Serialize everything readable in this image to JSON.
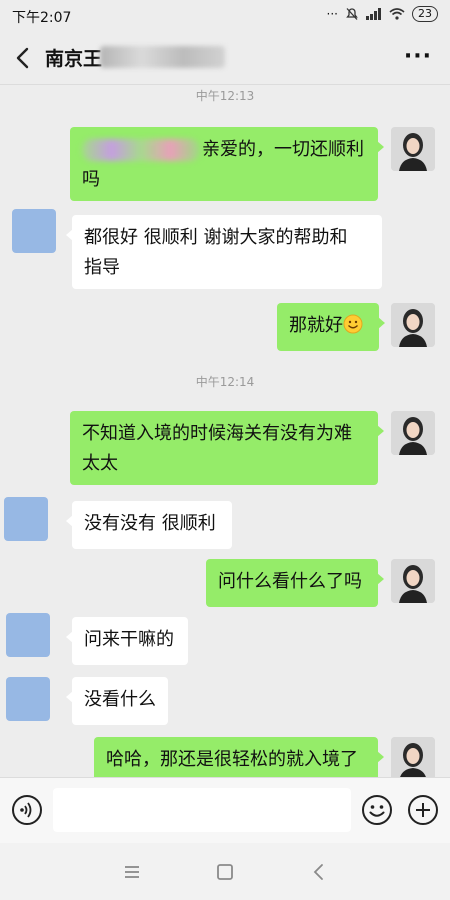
{
  "status_bar": {
    "time": "下午2:07",
    "signal_text": "···",
    "battery": "23"
  },
  "header": {
    "title": "南京王",
    "back_icon": "chevron-left-icon",
    "more_label": "···"
  },
  "messages": [
    {
      "kind": "time",
      "text": "中午12:13"
    },
    {
      "kind": "msg",
      "side": "self",
      "text": "亲爱的，一切还顺利吗",
      "lines": [
        "亲爱的，一切还顺利",
        "吗"
      ],
      "has_blurred_prefix": true
    },
    {
      "kind": "msg",
      "side": "other",
      "text": "都很好 很顺利 谢谢大家的帮助和指导",
      "lines": [
        "都很好 很顺利 谢谢大家的帮助和",
        "指导"
      ]
    },
    {
      "kind": "msg",
      "side": "self",
      "text": "那就好",
      "lines": [
        "那就好"
      ],
      "emoji": "smile-emoji"
    },
    {
      "kind": "time",
      "text": "中午12:14"
    },
    {
      "kind": "msg",
      "side": "self",
      "text": "不知道入境的时候海关有没有为难太太",
      "lines": [
        "不知道入境的时候海关有没有为难",
        "太太"
      ]
    },
    {
      "kind": "msg",
      "side": "other",
      "text": "没有没有 很顺利",
      "lines": [
        "没有没有 很顺利"
      ]
    },
    {
      "kind": "msg",
      "side": "self",
      "text": "问什么看什么了吗",
      "lines": [
        "问什么看什么了吗"
      ]
    },
    {
      "kind": "msg",
      "side": "other",
      "text": "问来干嘛的",
      "lines": [
        "问来干嘛的"
      ]
    },
    {
      "kind": "msg",
      "side": "other",
      "text": "没看什么",
      "lines": [
        "没看什么"
      ]
    },
    {
      "kind": "msg",
      "side": "self",
      "text": "哈哈，那还是很轻松的就入境了",
      "lines": [
        "哈哈，那还是很轻松的就入境了"
      ]
    }
  ],
  "input_bar": {
    "placeholder": "",
    "voice_icon": "voice-icon",
    "emoji_icon": "emoji-icon",
    "plus_icon": "plus-icon"
  },
  "nav_bar": {
    "icons": [
      "menu-icon",
      "home-icon",
      "back-icon"
    ]
  },
  "colors": {
    "self_bubble": "#95ec69",
    "other_bubble": "#ffffff",
    "background": "#ededed",
    "other_avatar": "#97b8e4"
  }
}
